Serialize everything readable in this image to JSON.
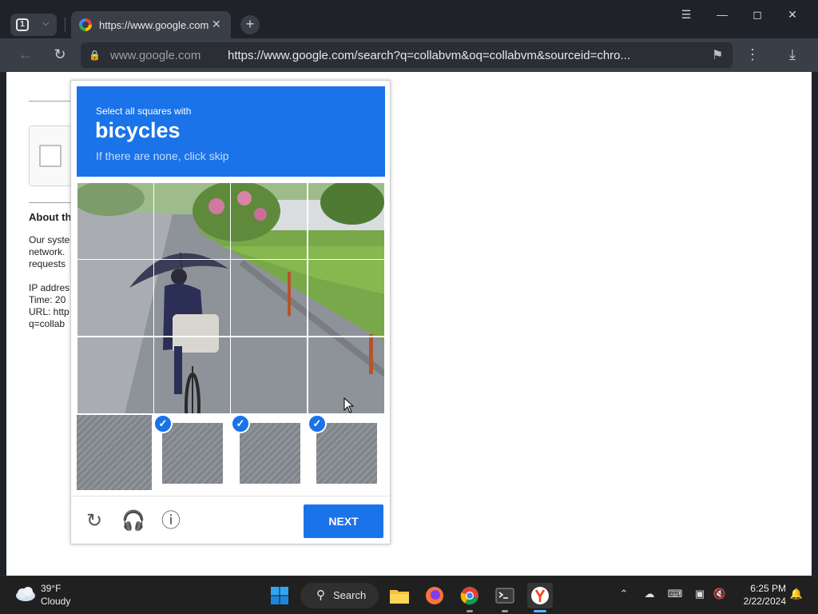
{
  "browser": {
    "tab_count": "1",
    "tab_title": "https://www.google.com",
    "omnibox_domain": "www.google.com",
    "omnibox_url": "https://www.google.com/search?q=collabvm&oq=collabvm&sourceid=chro..."
  },
  "background_page": {
    "about_heading": "About th",
    "line1": "Our syste",
    "line2": "network.",
    "line3": "requests",
    "line4": "IP addres",
    "line5": "Time: 20",
    "line6": "URL: http",
    "line7": "q=collab"
  },
  "captcha": {
    "instruction": "Select all squares with",
    "target": "bicycles",
    "hint": "If there are none, click skip",
    "next_label": "NEXT",
    "accent_color": "#1a73e8"
  },
  "taskbar": {
    "temperature": "39°F",
    "condition": "Cloudy",
    "search_label": "Search",
    "time": "6:25 PM",
    "date": "2/22/2024"
  }
}
